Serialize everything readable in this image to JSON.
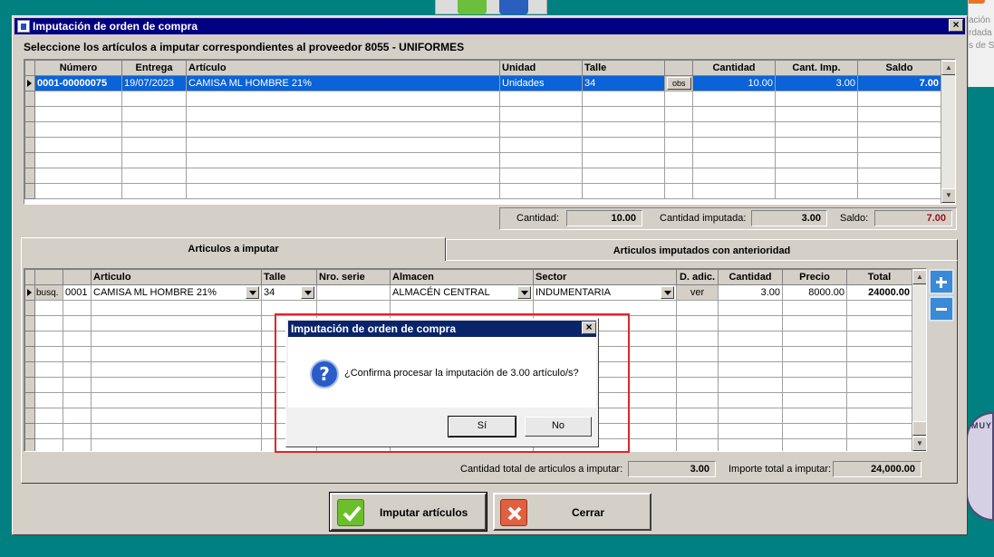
{
  "background": {
    "side_text": [
      "ación",
      "rdada",
      "s de S"
    ],
    "emblem_text": "MUY"
  },
  "window": {
    "title": "Imputación de orden de compra",
    "heading": "Seleccione los artículos a imputar correspondientes al proveedor 8055 - UNIFORMES"
  },
  "orders_grid": {
    "columns": [
      "Número",
      "Entrega",
      "Artículo",
      "Unidad",
      "Talle",
      "",
      "Cantidad",
      "Cant. Imp.",
      "Saldo"
    ],
    "rows": [
      {
        "numero": "0001-00000075",
        "entrega": "19/07/2023",
        "articulo": "CAMISA ML HOMBRE 21%",
        "unidad": "Unidades",
        "talle": "34",
        "obs": "obs",
        "cantidad": "10.00",
        "cant_imp": "3.00",
        "saldo": "7.00"
      }
    ]
  },
  "summary_top": {
    "cantidad_label": "Cantidad:",
    "cantidad": "10.00",
    "imputada_label": "Cantidad imputada:",
    "imputada": "3.00",
    "saldo_label": "Saldo:",
    "saldo": "7.00",
    "saldo_color": "#a0101c"
  },
  "tabs": [
    "Articulos a imputar",
    "Articulos imputados con anterioridad"
  ],
  "items_grid": {
    "columns": [
      "",
      "",
      "Articulo",
      "Talle",
      "Nro. serie",
      "Almacen",
      "Sector",
      "D. adic.",
      "Cantidad",
      "Precio",
      "Total"
    ],
    "rows": [
      {
        "busq": "busq.",
        "codigo": "0001",
        "articulo": "CAMISA ML HOMBRE 21%",
        "talle": "34",
        "serie": "",
        "almacen": "ALMACÉN CENTRAL",
        "sector": "INDUMENTARIA",
        "dadic": "ver",
        "cantidad": "3.00",
        "precio": "8000.00",
        "total": "24000.00"
      }
    ]
  },
  "summary_bottom": {
    "total_cant_label": "Cantidad total de articulos a imputar:",
    "total_cant": "3.00",
    "importe_label": "Importe total a imputar:",
    "importe": "24,000.00"
  },
  "buttons": {
    "imputar": "Imputar artículos",
    "cerrar": "Cerrar"
  },
  "dialog": {
    "title": "Imputación de orden de compra",
    "message": "¿Confirma procesar la imputación de 3.00 artículo/s?",
    "icon": "?",
    "yes": "Sí",
    "no": "No"
  },
  "colors": {
    "titlebar": "#000080",
    "selection": "#0a63d8",
    "highlight_frame": "#e0262a"
  }
}
